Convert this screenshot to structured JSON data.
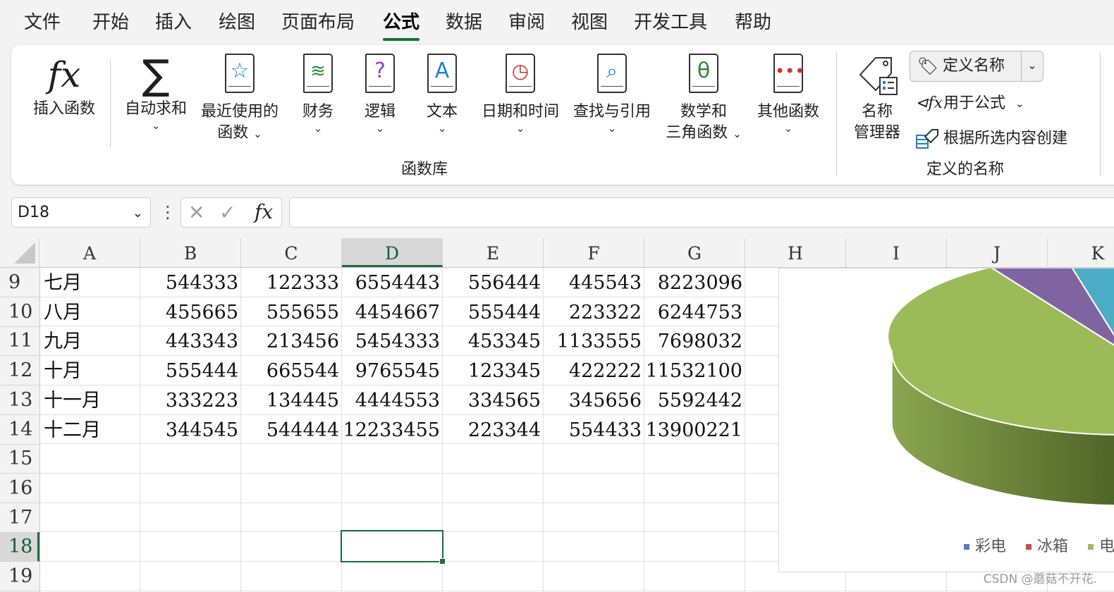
{
  "menu": {
    "tabs": [
      {
        "label": "文件"
      },
      {
        "label": "开始"
      },
      {
        "label": "插入"
      },
      {
        "label": "绘图"
      },
      {
        "label": "页面布局"
      },
      {
        "label": "公式"
      },
      {
        "label": "数据"
      },
      {
        "label": "审阅"
      },
      {
        "label": "视图"
      },
      {
        "label": "开发工具"
      },
      {
        "label": "帮助"
      }
    ],
    "active": "公式"
  },
  "ribbon": {
    "insert_function": "插入函数",
    "autosum": "自动求和",
    "recent_line1": "最近使用的",
    "recent_line2": "函数",
    "financial": "财务",
    "logical": "逻辑",
    "text": "文本",
    "datetime": "日期和时间",
    "lookup": "查找与引用",
    "math_line1": "数学和",
    "math_line2": "三角函数",
    "other": "其他函数",
    "function_library_label": "函数库",
    "name_manager_line1": "名称",
    "name_manager_line2": "管理器",
    "define_name": "定义名称",
    "use_in_formula": "用于公式",
    "create_from_selection": "根据所选内容创建",
    "defined_names_label": "定义的名称"
  },
  "formula_bar": {
    "name_box": "D18",
    "formula": ""
  },
  "sheet": {
    "columns": [
      "A",
      "B",
      "C",
      "D",
      "E",
      "F",
      "G",
      "H",
      "I",
      "J",
      "K"
    ],
    "selected_column": "D",
    "row_numbers": [
      "9",
      "10",
      "11",
      "12",
      "13",
      "14",
      "15",
      "16",
      "17",
      "18",
      "19"
    ],
    "selected_row": "18",
    "rows": [
      [
        "七月",
        "544333",
        "122333",
        "6554443",
        "556444",
        "445543",
        "8223096"
      ],
      [
        "八月",
        "455665",
        "555655",
        "4454667",
        "555444",
        "223322",
        "6244753"
      ],
      [
        "九月",
        "443343",
        "213456",
        "5454333",
        "453345",
        "1133555",
        "7698032"
      ],
      [
        "十月",
        "555444",
        "665544",
        "9765545",
        "123345",
        "422222",
        "11532100"
      ],
      [
        "十一月",
        "333223",
        "134445",
        "4444553",
        "334565",
        "345656",
        "5592442"
      ],
      [
        "十二月",
        "344545",
        "544444",
        "12233455",
        "223344",
        "554433",
        "13900221"
      ]
    ]
  },
  "chart": {
    "legend": [
      {
        "label": "彩电",
        "color": "#4f81bd"
      },
      {
        "label": "冰箱",
        "color": "#c0504d"
      },
      {
        "label": "电",
        "color": "#9bbb59"
      }
    ]
  },
  "watermark": "CSDN @蘑菇不开花."
}
